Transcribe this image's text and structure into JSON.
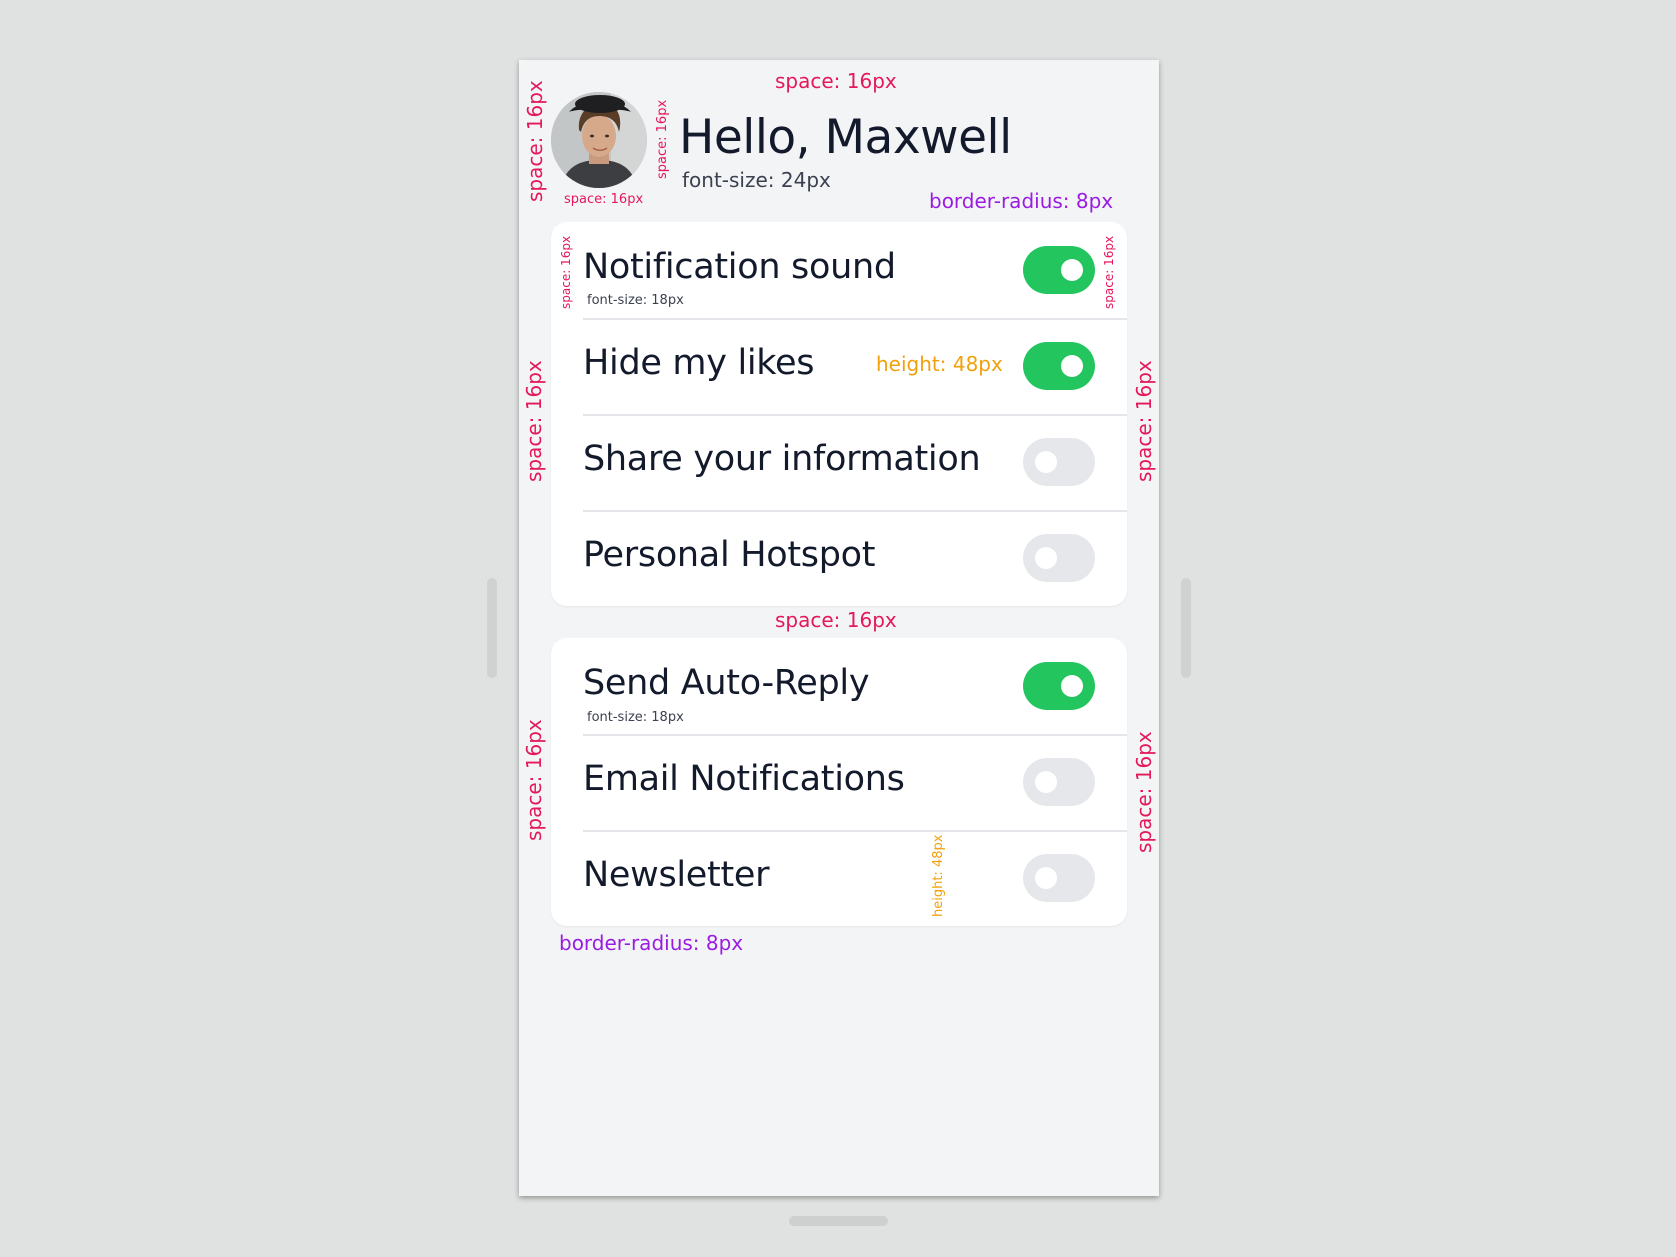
{
  "header": {
    "greeting": "Hello, Maxwell",
    "avatar_alt": "user avatar photo"
  },
  "settings_group_1": [
    {
      "label": "Notification sound",
      "on": true
    },
    {
      "label": "Hide my likes",
      "on": true
    },
    {
      "label": "Share your information",
      "on": false
    },
    {
      "label": "Personal Hotspot",
      "on": false
    }
  ],
  "settings_group_2": [
    {
      "label": "Send Auto-Reply",
      "on": true
    },
    {
      "label": "Email Notifications",
      "on": false
    },
    {
      "label": "Newsletter",
      "on": false
    }
  ],
  "annotations": {
    "space_top": "space: 16px",
    "space_left_header": "space: 16px",
    "space_avatar_bottom": "space: 16px",
    "space_avatar_right": "space: 16px",
    "greeting_font": "font-size: 24px",
    "radius_header": "border-radius: 8px",
    "card1_space_left_small": "space: 16px",
    "card1_space_right_small": "space: 16px",
    "row1_font": "font-size: 18px",
    "row2_height": "height: 48px",
    "card1_space_left": "space: 16px",
    "card1_space_right": "space: 16px",
    "space_between": "space: 16px",
    "row5_font": "font-size: 18px",
    "card2_space_left": "space: 16px",
    "card2_space_right": "space: 16px",
    "row7_height": "height: 48px",
    "radius_bottom": "border-radius: 8px"
  },
  "colors": {
    "toggle_on": "#22c55e",
    "toggle_off": "#e5e7eb",
    "annotation_space": "#e4185a",
    "annotation_radius": "#9a1ce0",
    "annotation_height": "#f0a10c"
  }
}
